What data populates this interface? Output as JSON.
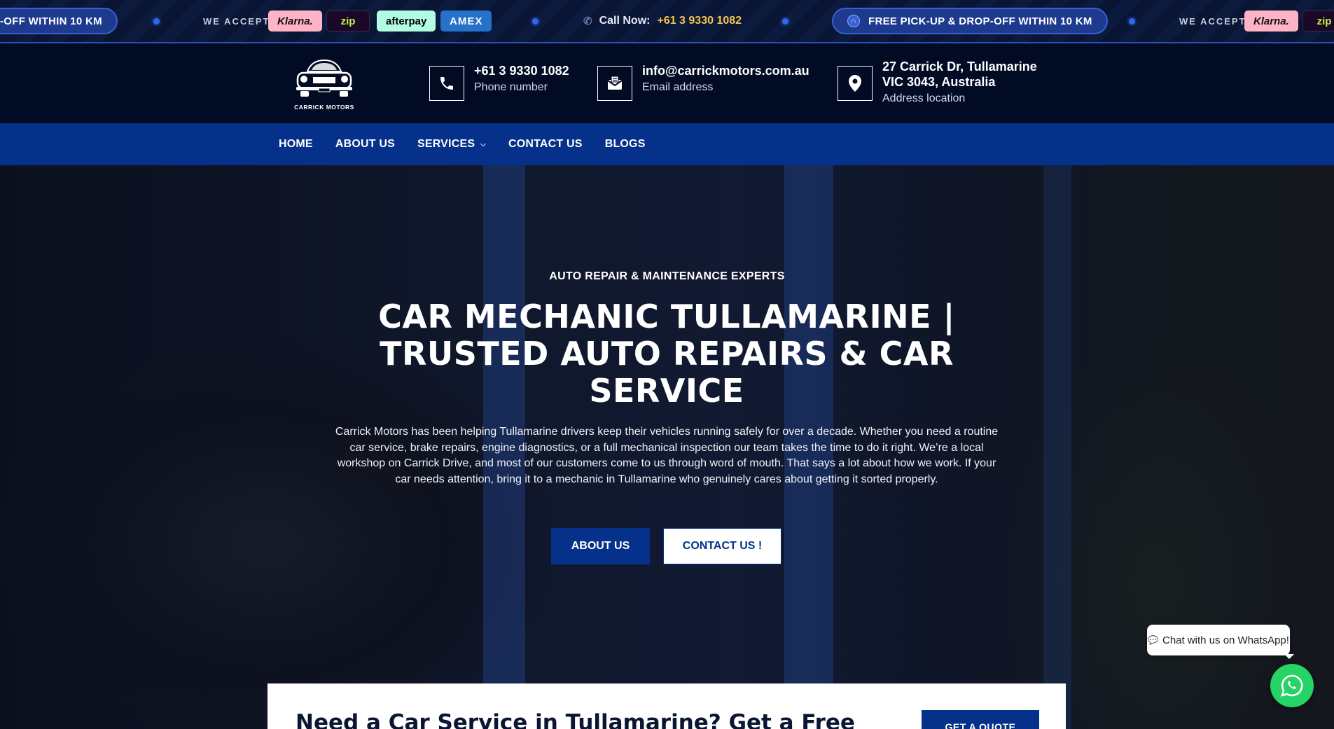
{
  "ticker": {
    "offer_text": "FREE PICK-UP & DROP-OFF WITHIN 10 KM",
    "offer_text_partial": "-OFF WITHIN 10 KM",
    "we_accept": "WE ACCEPT",
    "payments": [
      "Klarna.",
      "zip",
      "afterpay",
      "AMEX"
    ],
    "call_label": "Call Now:",
    "call_number": "+61 3 9330 1082"
  },
  "header": {
    "logo_text": "CARRICK MOTORS",
    "phone": {
      "title": "+61 3 9330 1082",
      "sub": "Phone number",
      "icon": "phone-icon"
    },
    "email": {
      "title": "info@carrickmotors.com.au",
      "sub": "Email address",
      "icon": "envelope-icon"
    },
    "address": {
      "line1": "27 Carrick Dr, Tullamarine",
      "line2": "VIC 3043, Australia",
      "sub": "Address location",
      "icon": "map-pin-icon"
    }
  },
  "nav": {
    "items": [
      "HOME",
      "ABOUT US",
      "SERVICES",
      "CONTACT US",
      "BLOGS"
    ]
  },
  "hero": {
    "eyebrow": "AUTO REPAIR & MAINTENANCE EXPERTS",
    "title_line1": "CAR MECHANIC TULLAMARINE |",
    "title_line2": "TRUSTED AUTO REPAIRS & CAR",
    "title_line3": "SERVICE",
    "description": "Carrick Motors has been helping Tullamarine drivers keep their vehicles running safely for over a decade. Whether you need a routine car service, brake repairs, engine diagnostics, or a full mechanical inspection our team takes the time to do it right. We’re a local workshop on Carrick Drive, and most of our customers come to us through word of mouth. That says a lot about how we work. If your car needs attention, bring it to a mechanic in Tullamarine who genuinely cares about getting it sorted properly.",
    "btn_about": "ABOUT US",
    "btn_contact": "CONTACT US !"
  },
  "quote": {
    "title": "Need a Car Service in Tullamarine? Get a Free",
    "button": "GET A QUOTE"
  },
  "whatsapp": {
    "bubble": "Chat with us on WhatsApp!"
  },
  "colors": {
    "navy": "#020b24",
    "nav_blue": "#05318a",
    "accent_yellow": "#f5c64b",
    "whatsapp_green": "#25d366"
  }
}
